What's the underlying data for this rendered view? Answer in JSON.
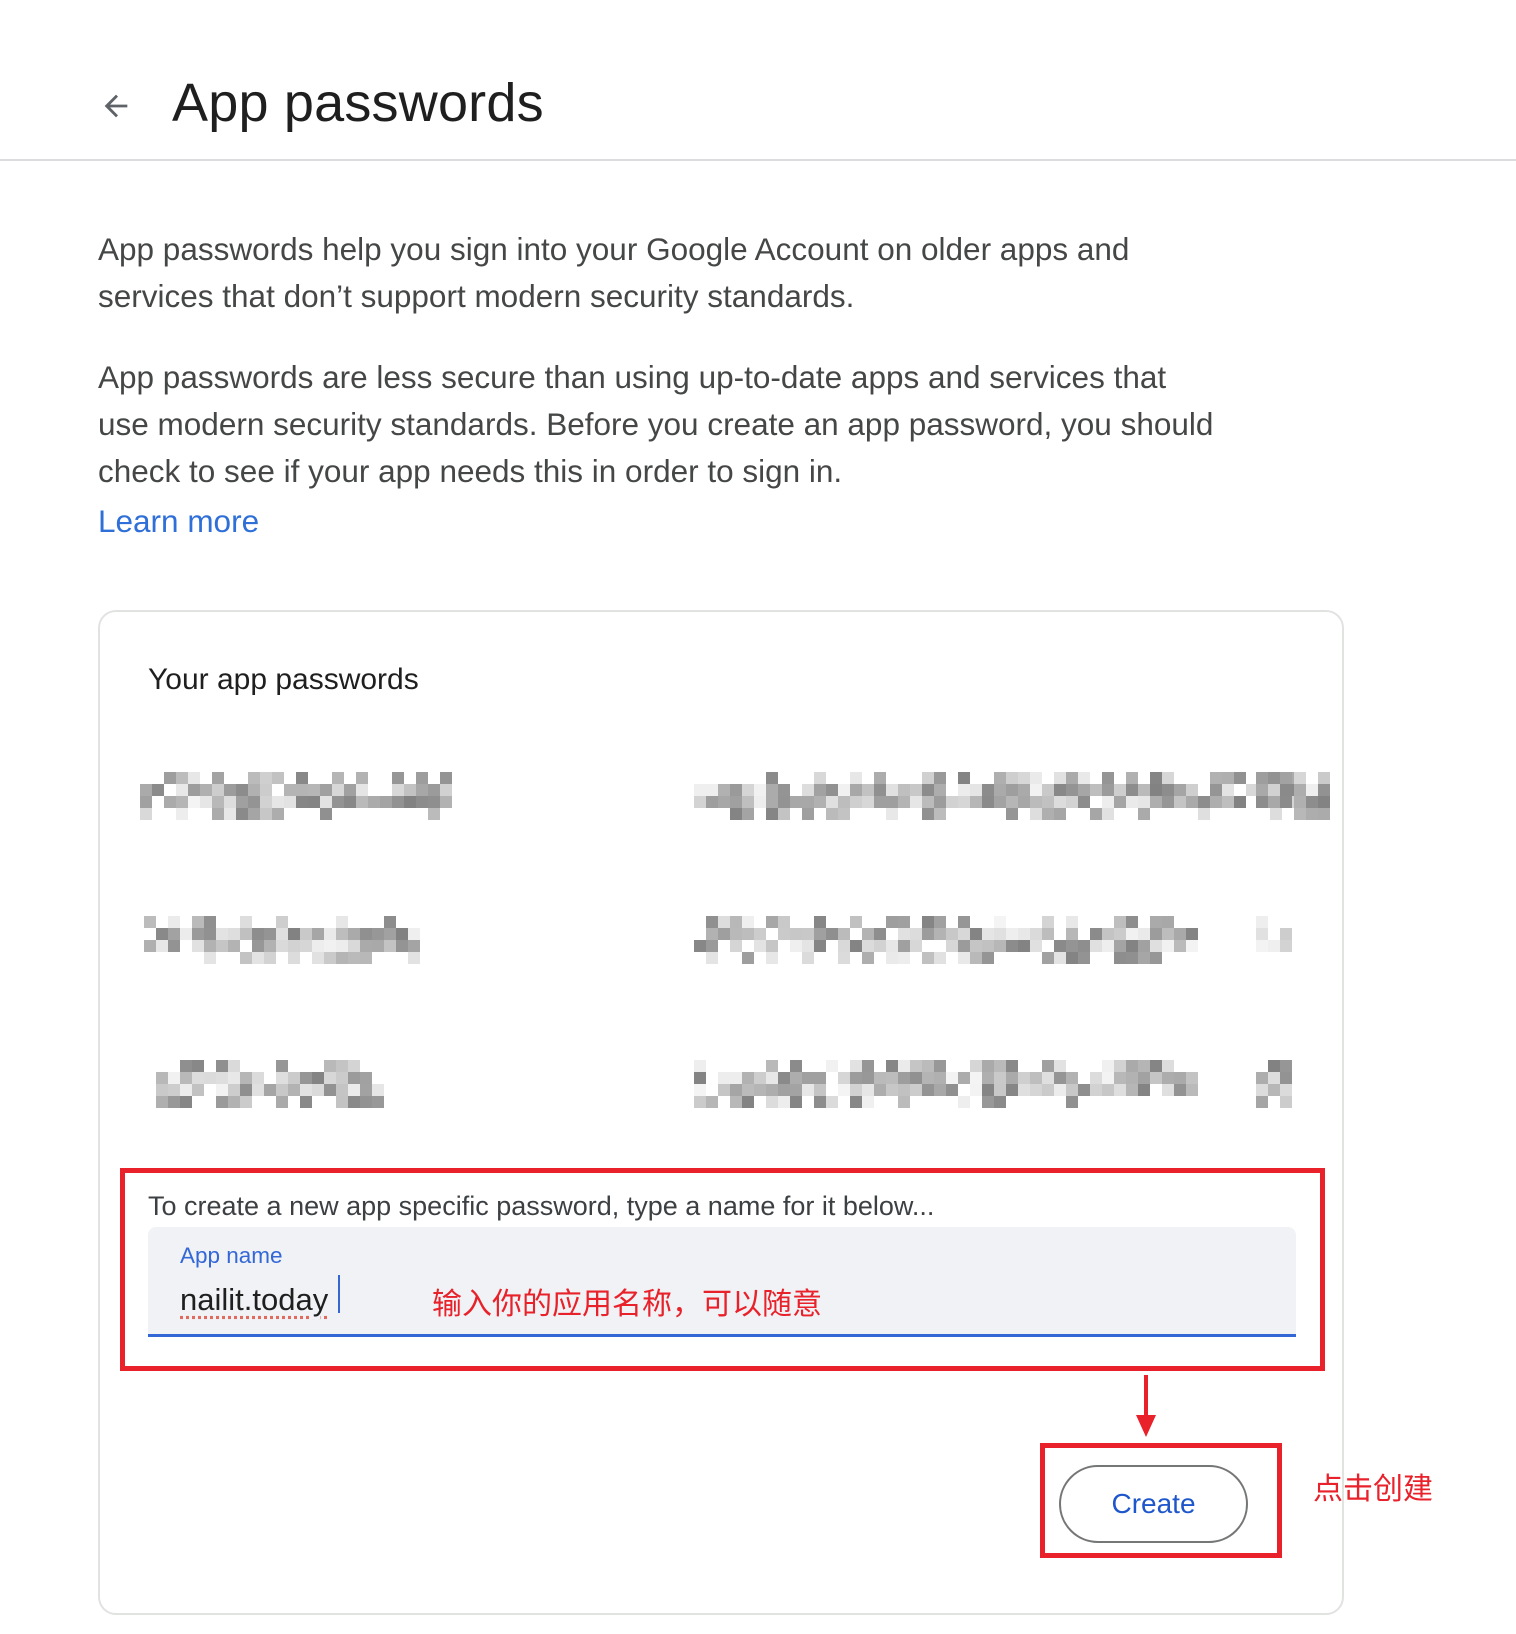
{
  "header": {
    "back_icon": "arrow-left-icon",
    "title": "App passwords"
  },
  "description": {
    "paragraph_1": "App passwords help you sign into your Google Account on older apps and services that don’t support modern security standards.",
    "paragraph_2": "App passwords are less secure than using up-to-date apps and services that use modern security standards. Before you create an app password, you should check to see if your app needs this in order to sign in.",
    "learn_more": "Learn more"
  },
  "card": {
    "title": "Your app passwords",
    "rows": [
      {
        "name": "[redacted]",
        "password": "[redacted]",
        "action_icon": "delete-icon (redacted)"
      },
      {
        "name": "[redacted]",
        "password": "[redacted]",
        "action_icon": "delete-icon (redacted)"
      },
      {
        "name": "[redacted]",
        "password": "[redacted]",
        "action_icon": "delete-icon (redacted)"
      }
    ],
    "create": {
      "helper_text": "To create a new app specific password, type a name for it below...",
      "field_label": "App name",
      "field_value": "nailit.today",
      "button_label": "Create"
    }
  },
  "annotations": {
    "input_hint": "输入你的应用名称，可以随意",
    "click_hint": "点击创建",
    "color": "#e8212a"
  },
  "colors": {
    "accent_blue": "#3367d6",
    "link_blue": "#2f6fd8",
    "field_bg": "#f0f2f5"
  }
}
